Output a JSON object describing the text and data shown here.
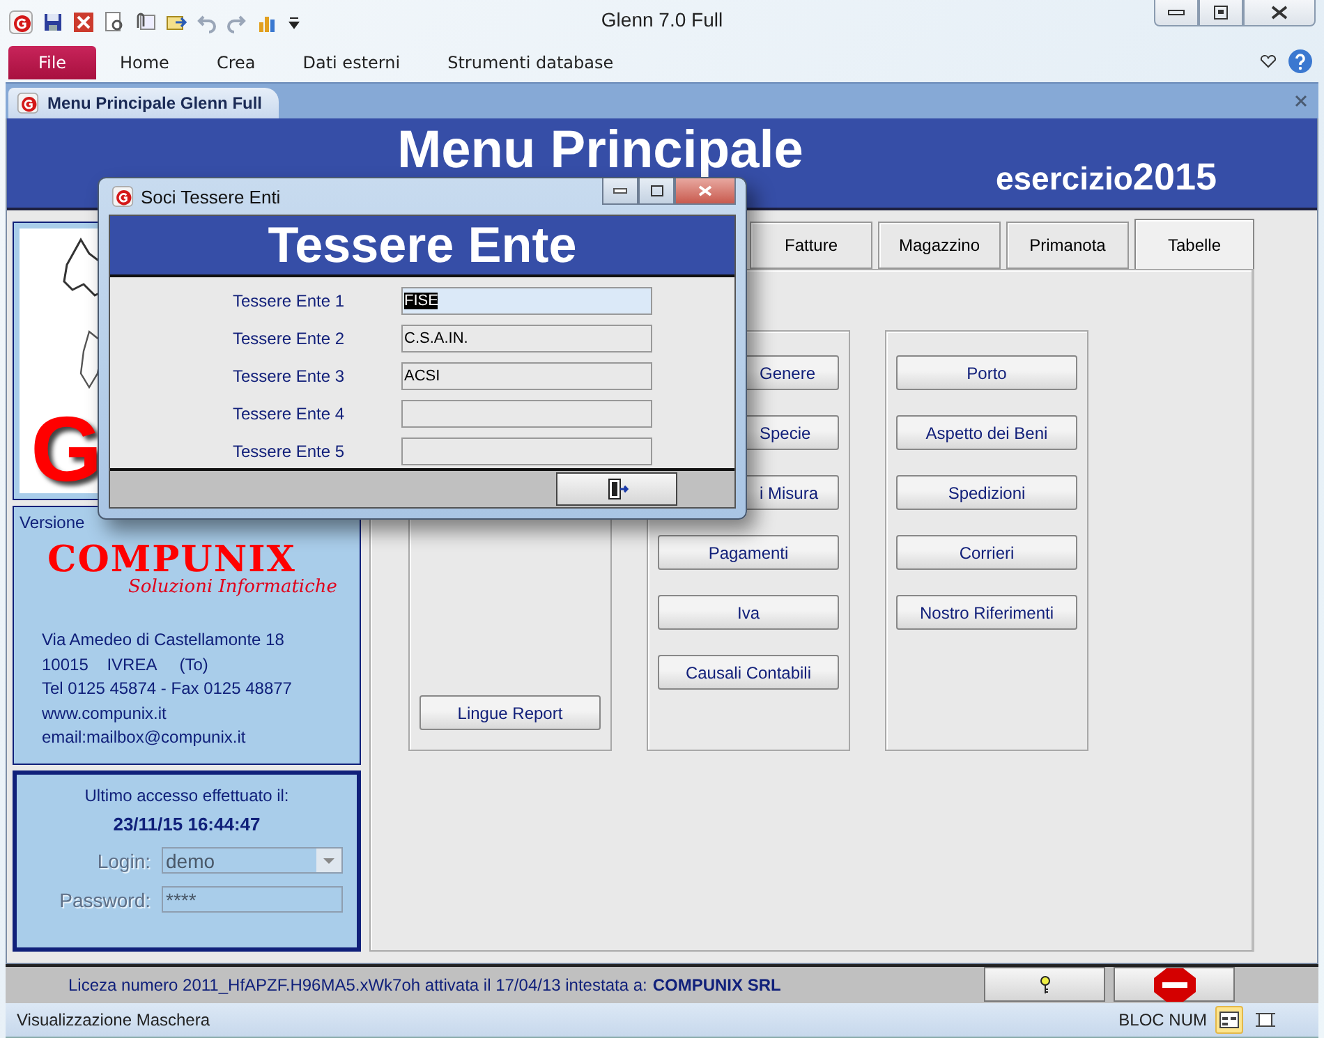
{
  "window": {
    "title": "Glenn 7.0 Full"
  },
  "ribbon_tabs": [
    {
      "label": "File",
      "kind": "file"
    },
    {
      "label": "Home",
      "kind": "tab"
    },
    {
      "label": "Crea",
      "kind": "tab"
    },
    {
      "label": "Dati esterni",
      "kind": "tab"
    },
    {
      "label": "Strumenti database",
      "kind": "tab"
    }
  ],
  "document_tab": {
    "title": "Menu Principale Glenn Full"
  },
  "form": {
    "title": "Menu Principale",
    "year_label": "esercizio",
    "year": "2015"
  },
  "sidebar": {
    "logo_letter": "G",
    "version": "Versione",
    "brand": "COMPUNIX",
    "tagline": "Soluzioni Informatiche",
    "address_lines": [
      "Via Amedeo di Castellamonte 18",
      "10015    IVREA     (To)",
      "Tel 0125 45874 - Fax 0125 48877",
      "www.compunix.it",
      "email:mailbox@compunix.it"
    ],
    "last_access_label": "Ultimo accesso effettuato il:",
    "last_access": "23/11/15 16:44:47",
    "login": {
      "label": "Login:",
      "value": "demo",
      "disabled": true
    },
    "password": {
      "label": "Password:",
      "value": "****",
      "disabled": true
    }
  },
  "section_tabs": [
    {
      "label": "Fatture",
      "selected": false
    },
    {
      "label": "Magazzino",
      "selected": false
    },
    {
      "label": "Primanota",
      "selected": false
    },
    {
      "label": "Tabelle",
      "selected": true
    }
  ],
  "groups": [
    {
      "buttons": [
        {
          "label": "Lingue Report",
          "covered": false
        }
      ]
    },
    {
      "buttons": [
        {
          "label": "Genere",
          "covered": true
        },
        {
          "label": "Specie",
          "covered": true
        },
        {
          "label": "i Misura",
          "covered": true
        },
        {
          "label": "Pagamenti",
          "covered": false
        },
        {
          "label": "Iva",
          "covered": false
        },
        {
          "label": "Causali Contabili",
          "covered": false
        }
      ]
    },
    {
      "buttons": [
        {
          "label": "Porto",
          "covered": false
        },
        {
          "label": "Aspetto dei Beni",
          "covered": false
        },
        {
          "label": "Spedizioni",
          "covered": false
        },
        {
          "label": "Corrieri",
          "covered": false
        },
        {
          "label": "Nostro Riferimenti",
          "covered": false
        }
      ]
    }
  ],
  "license": {
    "text": "Liceza numero 2011_HfAPZF.H96MA5.xWk7oh attivata il 17/04/13 intestata a:",
    "holder": "COMPUNIX SRL"
  },
  "status_bar": {
    "text": "Visualizzazione Maschera",
    "indicator": "BLOC NUM"
  },
  "dialog": {
    "title": "Soci Tessere Enti",
    "header": "Tessere Ente",
    "fields": [
      {
        "label": "Tessere Ente 1",
        "value": "FISE",
        "focused": true
      },
      {
        "label": "Tessere Ente 2",
        "value": "C.S.A.IN.",
        "focused": false
      },
      {
        "label": "Tessere Ente 3",
        "value": "ACSI",
        "focused": false
      },
      {
        "label": "Tessere Ente 4",
        "focused": false
      },
      {
        "label": "Tessere Ente 5",
        "focused": false
      }
    ]
  }
}
